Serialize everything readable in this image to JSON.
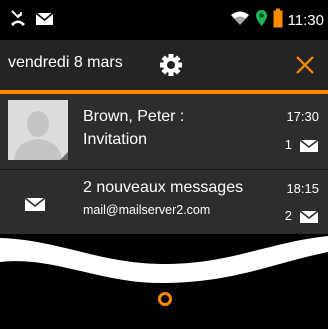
{
  "status_bar": {
    "time": "11:30",
    "icons": [
      "missed-call-icon",
      "envelope-icon",
      "wifi-icon",
      "location-icon",
      "battery-icon"
    ]
  },
  "header": {
    "date": "vendredi 8 mars",
    "icons": [
      "gear-icon",
      "close-icon"
    ]
  },
  "notifications": [
    {
      "title": "Brown, Peter :",
      "subtitle": "Invitation",
      "time": "17:30",
      "count": "1",
      "icon": "avatar-placeholder"
    },
    {
      "title": "2  nouveaux messages",
      "subtitle": "mail@mailserver2.com",
      "time": "18:15",
      "count": "2",
      "icon": "envelope-icon"
    }
  ],
  "colors": {
    "accent": "#ff8a00",
    "panel": "#2d2d2d",
    "header": "#242424",
    "background": "#000000"
  }
}
